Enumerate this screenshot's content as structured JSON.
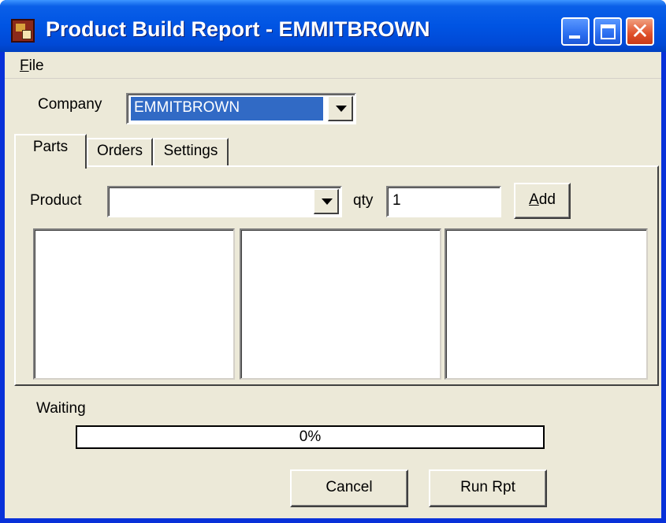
{
  "window": {
    "title": "Product Build Report - EMMITBROWN",
    "minimize_icon": "minimize-icon",
    "maximize_icon": "maximize-icon",
    "close_icon": "close-icon",
    "close_glyph": "✕"
  },
  "menu": {
    "file_accel": "F",
    "file_rest": "ile"
  },
  "company": {
    "label": "Company",
    "selected": "EMMITBROWN"
  },
  "tabs": [
    {
      "label": "Parts",
      "active": true
    },
    {
      "label": "Orders",
      "active": false
    },
    {
      "label": "Settings",
      "active": false
    }
  ],
  "parts": {
    "product_label": "Product",
    "product_value": "",
    "qty_label": "qty",
    "qty_value": "1",
    "add_accel": "A",
    "add_rest": "dd"
  },
  "status": {
    "text": "Waiting",
    "progress_label": "0%",
    "progress": 0
  },
  "buttons": {
    "cancel": "Cancel",
    "run": "Run Rpt"
  },
  "colors": {
    "titlebar": "#0054e3",
    "face": "#ece9d8",
    "selection": "#316ac5",
    "close": "#e0502a"
  }
}
